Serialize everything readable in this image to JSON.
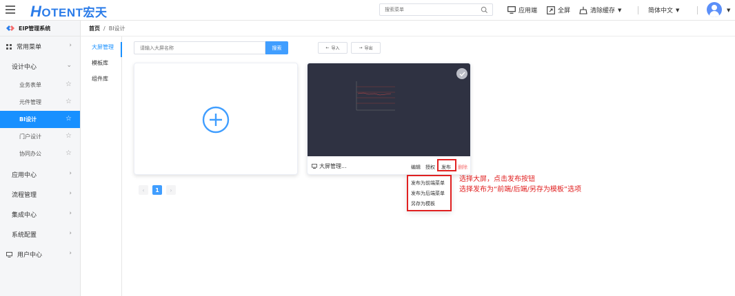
{
  "header": {
    "logo_mark": "H",
    "logo_text": "OTENT宏天",
    "search_placeholder": "搜索菜单",
    "app_label": "应用端",
    "fullscreen_label": "全屏",
    "clear_cache_label": "清除缓存",
    "language_label": "简体中文"
  },
  "sidebar": {
    "system_title": "EIP管理系统",
    "common_menu": "常用菜单",
    "design_center": "设计中心",
    "design_items": [
      "业务表单",
      "元件管理",
      "BI设计",
      "门户设计",
      "协同办公"
    ],
    "active_item": "BI设计",
    "bottom_items": [
      "应用中心",
      "流程管理",
      "集成中心",
      "系统配置",
      "用户中心"
    ]
  },
  "breadcrumb": {
    "home": "首页",
    "separator": "/",
    "current": "BI设计"
  },
  "tabs": [
    "大屏管理",
    "模板库",
    "组件库"
  ],
  "toolbar": {
    "search_placeholder": "请输入大屏名称",
    "search_button": "搜索",
    "import_button": "导入",
    "export_button": "导出"
  },
  "card": {
    "name": "大屏管理...",
    "actions": {
      "edit": "编辑",
      "authorize": "授权",
      "publish": "发布",
      "delete": "删除"
    }
  },
  "publish_menu": [
    "发布为前端菜单",
    "发布为后端菜单",
    "另存为模板"
  ],
  "annotations": [
    "选择大屏，点击发布按钮",
    "选择发布为“前端/后端/另存为模板”选项"
  ],
  "pagination": {
    "prev": "‹",
    "current": "1",
    "next": "›"
  },
  "colors": {
    "primary": "#1890ff",
    "annotation": "#e02020",
    "thumb_bg": "#2f3242"
  }
}
